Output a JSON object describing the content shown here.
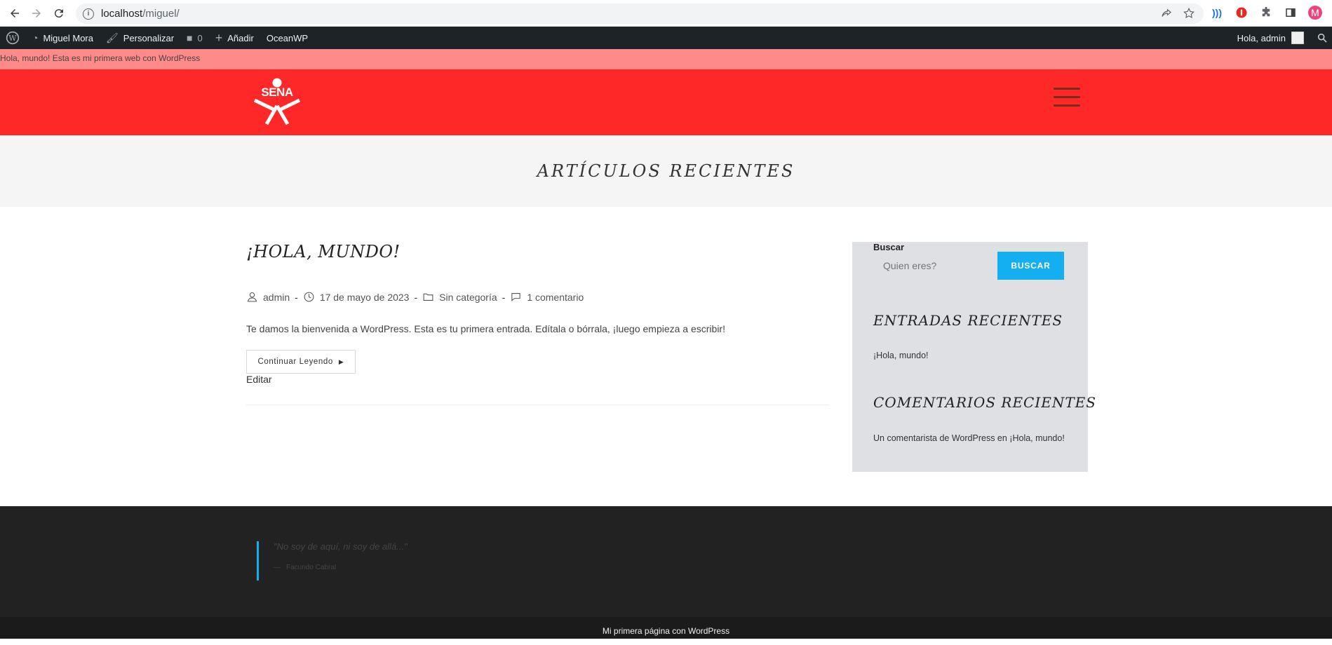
{
  "browser": {
    "url_host": "localhost",
    "url_path": "/miguel/",
    "avatar_letter": "M"
  },
  "adminbar": {
    "site_name": "Miguel Mora",
    "customize": "Personalizar",
    "comments_count": "0",
    "add_new": "Añadir",
    "theme": "OceanWP",
    "greeting": "Hola, admin"
  },
  "topbar": {
    "text": "Hola, mundo! Esta es mi primera web con WordPress"
  },
  "header": {
    "logo_text": "SENA",
    "colors": {
      "header_bg": "#ff2828",
      "topbar_bg": "#ff8a8a",
      "accent": "#13aff0"
    }
  },
  "page": {
    "title": "ARTÍCULOS RECIENTES"
  },
  "post": {
    "title": "¡HOLA, MUNDO!",
    "author": "admin",
    "date": "17 de mayo de 2023",
    "category": "Sin categoría",
    "comments": "1 comentario",
    "excerpt": "Te damos la bienvenida a WordPress. Esta es tu primera entrada. Edítala o bórrala, ¡luego empieza a escribir!",
    "read_more": "Continuar Leyendo",
    "edit": "Editar"
  },
  "sidebar": {
    "search_label": "Buscar",
    "search_placeholder": "Quien eres?",
    "search_button": "BUSCAR",
    "recent_posts_title": "ENTRADAS RECIENTES",
    "recent_post_1": "¡Hola, mundo!",
    "recent_comments_title": "COMENTARIOS RECIENTES",
    "recent_comment_1": "Un comentarista de WordPress en ¡Hola, mundo!"
  },
  "footer": {
    "quote": "\"No soy de aquí, ni soy de allá...\"",
    "quote_author": "Facundo Cabral",
    "copyright": "Mi primera página con WordPress"
  }
}
